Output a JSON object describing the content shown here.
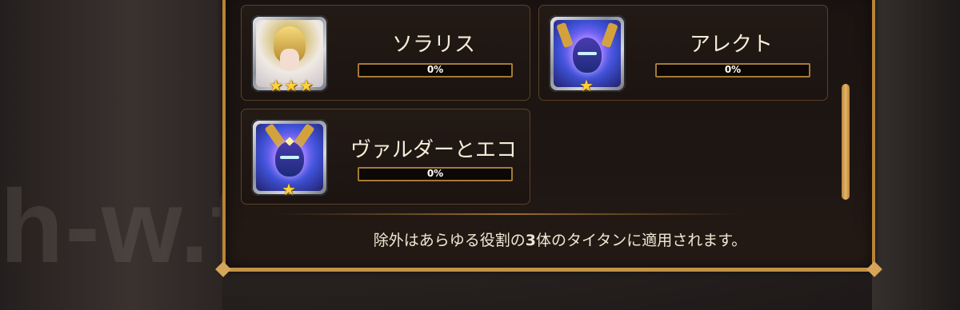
{
  "watermark": "h-w.fun",
  "heroes": [
    {
      "name": "ソラリス",
      "progress_percent": 0,
      "progress_text": "0%",
      "stars": 3,
      "icon": "solaris-portrait"
    },
    {
      "name": "アレクト",
      "progress_percent": 0,
      "progress_text": "0%",
      "stars": 1,
      "icon": "alecto-portrait"
    },
    {
      "name": "ヴァルダーとエコ",
      "progress_percent": 0,
      "progress_text": "0%",
      "stars": 1,
      "icon": "valder-echo-portrait"
    }
  ],
  "footer": {
    "before": "除外はあらゆる役割の",
    "bold": "3",
    "after": "体のタイタンに適用されます。"
  },
  "colors": {
    "gold": "#b88437",
    "text": "#f6ecd8",
    "star": "#ffd23a"
  }
}
